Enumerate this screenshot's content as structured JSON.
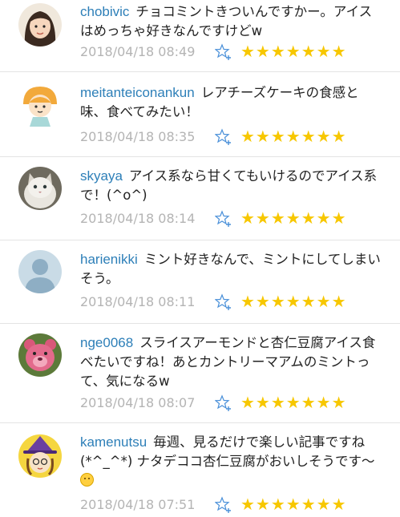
{
  "comments": [
    {
      "user": "chobivic",
      "text": "チョコミントきついんですかー。アイスはめっちゃ好きなんですけどw",
      "timestamp": "2018/04/18 08:49",
      "stars": "★★★★★★★",
      "avatar": "avatar-girl-icon"
    },
    {
      "user": "meitanteiconankun",
      "text": "レアチーズケーキの食感と味、食べてみたい！",
      "timestamp": "2018/04/18 08:35",
      "stars": "★★★★★★★",
      "avatar": "avatar-mushroom-icon"
    },
    {
      "user": "skyaya",
      "text": "アイス系なら甘くてもいけるのでアイス系で！(^o^)",
      "timestamp": "2018/04/18 08:14",
      "stars": "★★★★★★★",
      "avatar": "avatar-cat-icon"
    },
    {
      "user": "harienikki",
      "text": "ミント好きなんで、ミントにしてしまいそう。",
      "timestamp": "2018/04/18 08:11",
      "stars": "★★★★★★★",
      "avatar": "avatar-default-icon"
    },
    {
      "user": "nge0068",
      "text": "スライスアーモンドと杏仁豆腐アイス食べたいですね！あとカントリーマアムのミントって、気になるw",
      "timestamp": "2018/04/18 08:07",
      "stars": "★★★★★★★",
      "avatar": "avatar-pink-bear-icon"
    },
    {
      "user": "kamenutsu",
      "text": "毎週、見るだけで楽しい記事ですね(*^_^*) ナタデココ杏仁豆腐がおいしそうです～",
      "timestamp": "2018/04/18 07:51",
      "stars": "★★★★★★★",
      "avatar": "avatar-witch-icon"
    }
  ],
  "colors": {
    "username": "#2d7fb8",
    "timestamp": "#b4b4b4",
    "star": "#f7c700",
    "add_star": "#4a90d9"
  }
}
